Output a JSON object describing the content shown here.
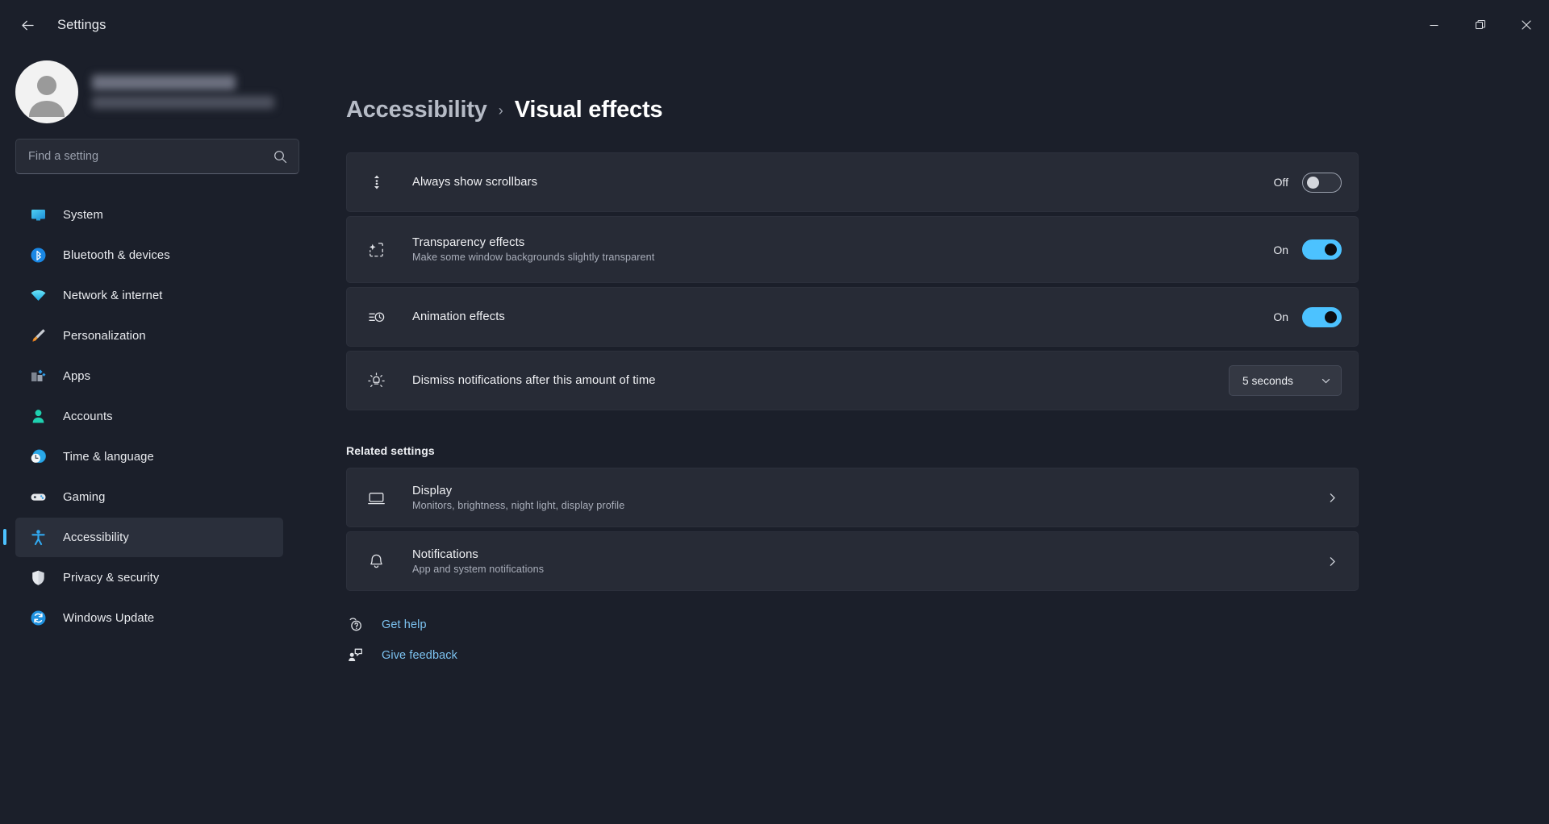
{
  "window": {
    "app_title": "Settings",
    "back_icon": "back-arrow-icon",
    "minimize_label": "Minimize",
    "maximize_label": "Restore",
    "close_label": "Close"
  },
  "account": {
    "name_redacted": "",
    "email_redacted": ""
  },
  "search": {
    "placeholder": "Find a setting",
    "value": "",
    "icon": "search-icon"
  },
  "sidebar": {
    "items": [
      {
        "label": "System",
        "icon": "system-icon",
        "selected": false
      },
      {
        "label": "Bluetooth & devices",
        "icon": "bluetooth-icon",
        "selected": false
      },
      {
        "label": "Network & internet",
        "icon": "wifi-icon",
        "selected": false
      },
      {
        "label": "Personalization",
        "icon": "paintbrush-icon",
        "selected": false
      },
      {
        "label": "Apps",
        "icon": "apps-icon",
        "selected": false
      },
      {
        "label": "Accounts",
        "icon": "person-icon",
        "selected": false
      },
      {
        "label": "Time & language",
        "icon": "clock-globe-icon",
        "selected": false
      },
      {
        "label": "Gaming",
        "icon": "gamepad-icon",
        "selected": false
      },
      {
        "label": "Accessibility",
        "icon": "accessibility-icon",
        "selected": true
      },
      {
        "label": "Privacy & security",
        "icon": "shield-icon",
        "selected": false
      },
      {
        "label": "Windows Update",
        "icon": "windows-update-icon",
        "selected": false
      }
    ]
  },
  "breadcrumb": {
    "root": "Accessibility",
    "separator": "›",
    "leaf": "Visual effects"
  },
  "settings": {
    "scrollbars": {
      "title": "Always show scrollbars",
      "icon": "scrollbar-icon",
      "state_label": "Off",
      "state_on": false
    },
    "transparency": {
      "title": "Transparency effects",
      "subtitle": "Make some window backgrounds slightly transparent",
      "icon": "sparkle-icon",
      "state_label": "On",
      "state_on": true
    },
    "animation": {
      "title": "Animation effects",
      "icon": "animation-icon",
      "state_label": "On",
      "state_on": true
    },
    "dismiss": {
      "title": "Dismiss notifications after this amount of time",
      "icon": "brightness-alert-icon",
      "value": "5 seconds",
      "chevron": "chevron-down-icon"
    }
  },
  "related": {
    "heading": "Related settings",
    "items": [
      {
        "title": "Display",
        "subtitle": "Monitors, brightness, night light, display profile",
        "icon": "monitor-icon",
        "chevron": "chevron-right-icon"
      },
      {
        "title": "Notifications",
        "subtitle": "App and system notifications",
        "icon": "bell-icon",
        "chevron": "chevron-right-icon"
      }
    ]
  },
  "footer": {
    "links": [
      {
        "label": "Get help",
        "icon": "help-question-icon"
      },
      {
        "label": "Give feedback",
        "icon": "feedback-person-icon"
      }
    ]
  },
  "colors": {
    "accent": "#4cc2ff",
    "link": "#7cc2f0",
    "window_bg": "#1b1f2a",
    "card_bg": "#272b36"
  }
}
